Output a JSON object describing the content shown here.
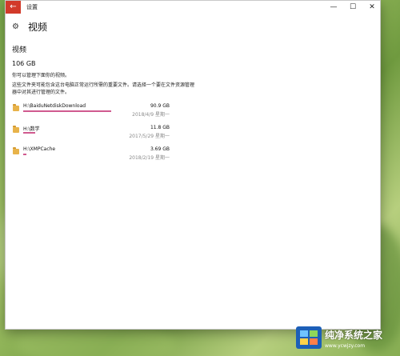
{
  "window": {
    "title": "设置",
    "back_glyph": "←",
    "controls": {
      "minimize": "—",
      "maximize": "☐",
      "close": "✕"
    }
  },
  "header": {
    "icon": "gear-icon",
    "title": "视频"
  },
  "section": {
    "title": "视频",
    "total_size": "106 GB",
    "description1": "你可以管理下面你的视频。",
    "description2": "这些文件夹可能包含这台电脑正常运行所需的重要文件。请选择一个要在文件资源管理器中对其进行管理的文件。"
  },
  "items": [
    {
      "path": "H:\\BaiduNetdiskDownload",
      "size": "90.9 GB",
      "date": "2018/4/9 星期一",
      "fill_fraction": 0.98
    },
    {
      "path": "H:\\数学",
      "size": "11.8 GB",
      "date": "2017/5/29 星期一",
      "fill_fraction": 0.13
    },
    {
      "path": "H:\\XMPCache",
      "size": "3.69 GB",
      "date": "2018/2/19 星期一",
      "fill_fraction": 0.04
    }
  ],
  "colors": {
    "accent_back": "#d23a2a",
    "bar": "#d05a8f",
    "folder": "#e8b34a"
  },
  "watermark": {
    "name": "纯净系统之家",
    "url": "www.ycwjzy.com"
  }
}
